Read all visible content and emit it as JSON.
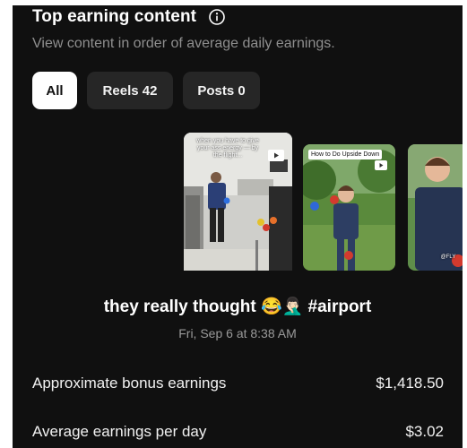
{
  "header": {
    "title": "Top earning content",
    "subtitle": "View content in order of average daily earnings."
  },
  "filters": [
    {
      "label": "All",
      "active": true
    },
    {
      "label": "Reels 42",
      "active": false
    },
    {
      "label": "Posts 0",
      "active": false
    }
  ],
  "carousel": {
    "items": [
      {
        "overlay_text": "when you have to give your ass energy — by the flight..."
      },
      {
        "overlay_text": "How to Do Upside Down"
      },
      {
        "overlay_text": "@FLY"
      }
    ]
  },
  "selected_post": {
    "caption": "they really thought 😂🤦🏻‍♂️ #airport",
    "date": "Fri, Sep 6 at 8:38 AM"
  },
  "stats": [
    {
      "label": "Approximate bonus earnings",
      "value": "$1,418.50"
    },
    {
      "label": "Average earnings per day",
      "value": "$3.02"
    }
  ],
  "colors": {
    "background": "#101010",
    "chip_inactive": "#262626",
    "chip_active": "#ffffff",
    "muted_text": "#8f8f8f"
  }
}
